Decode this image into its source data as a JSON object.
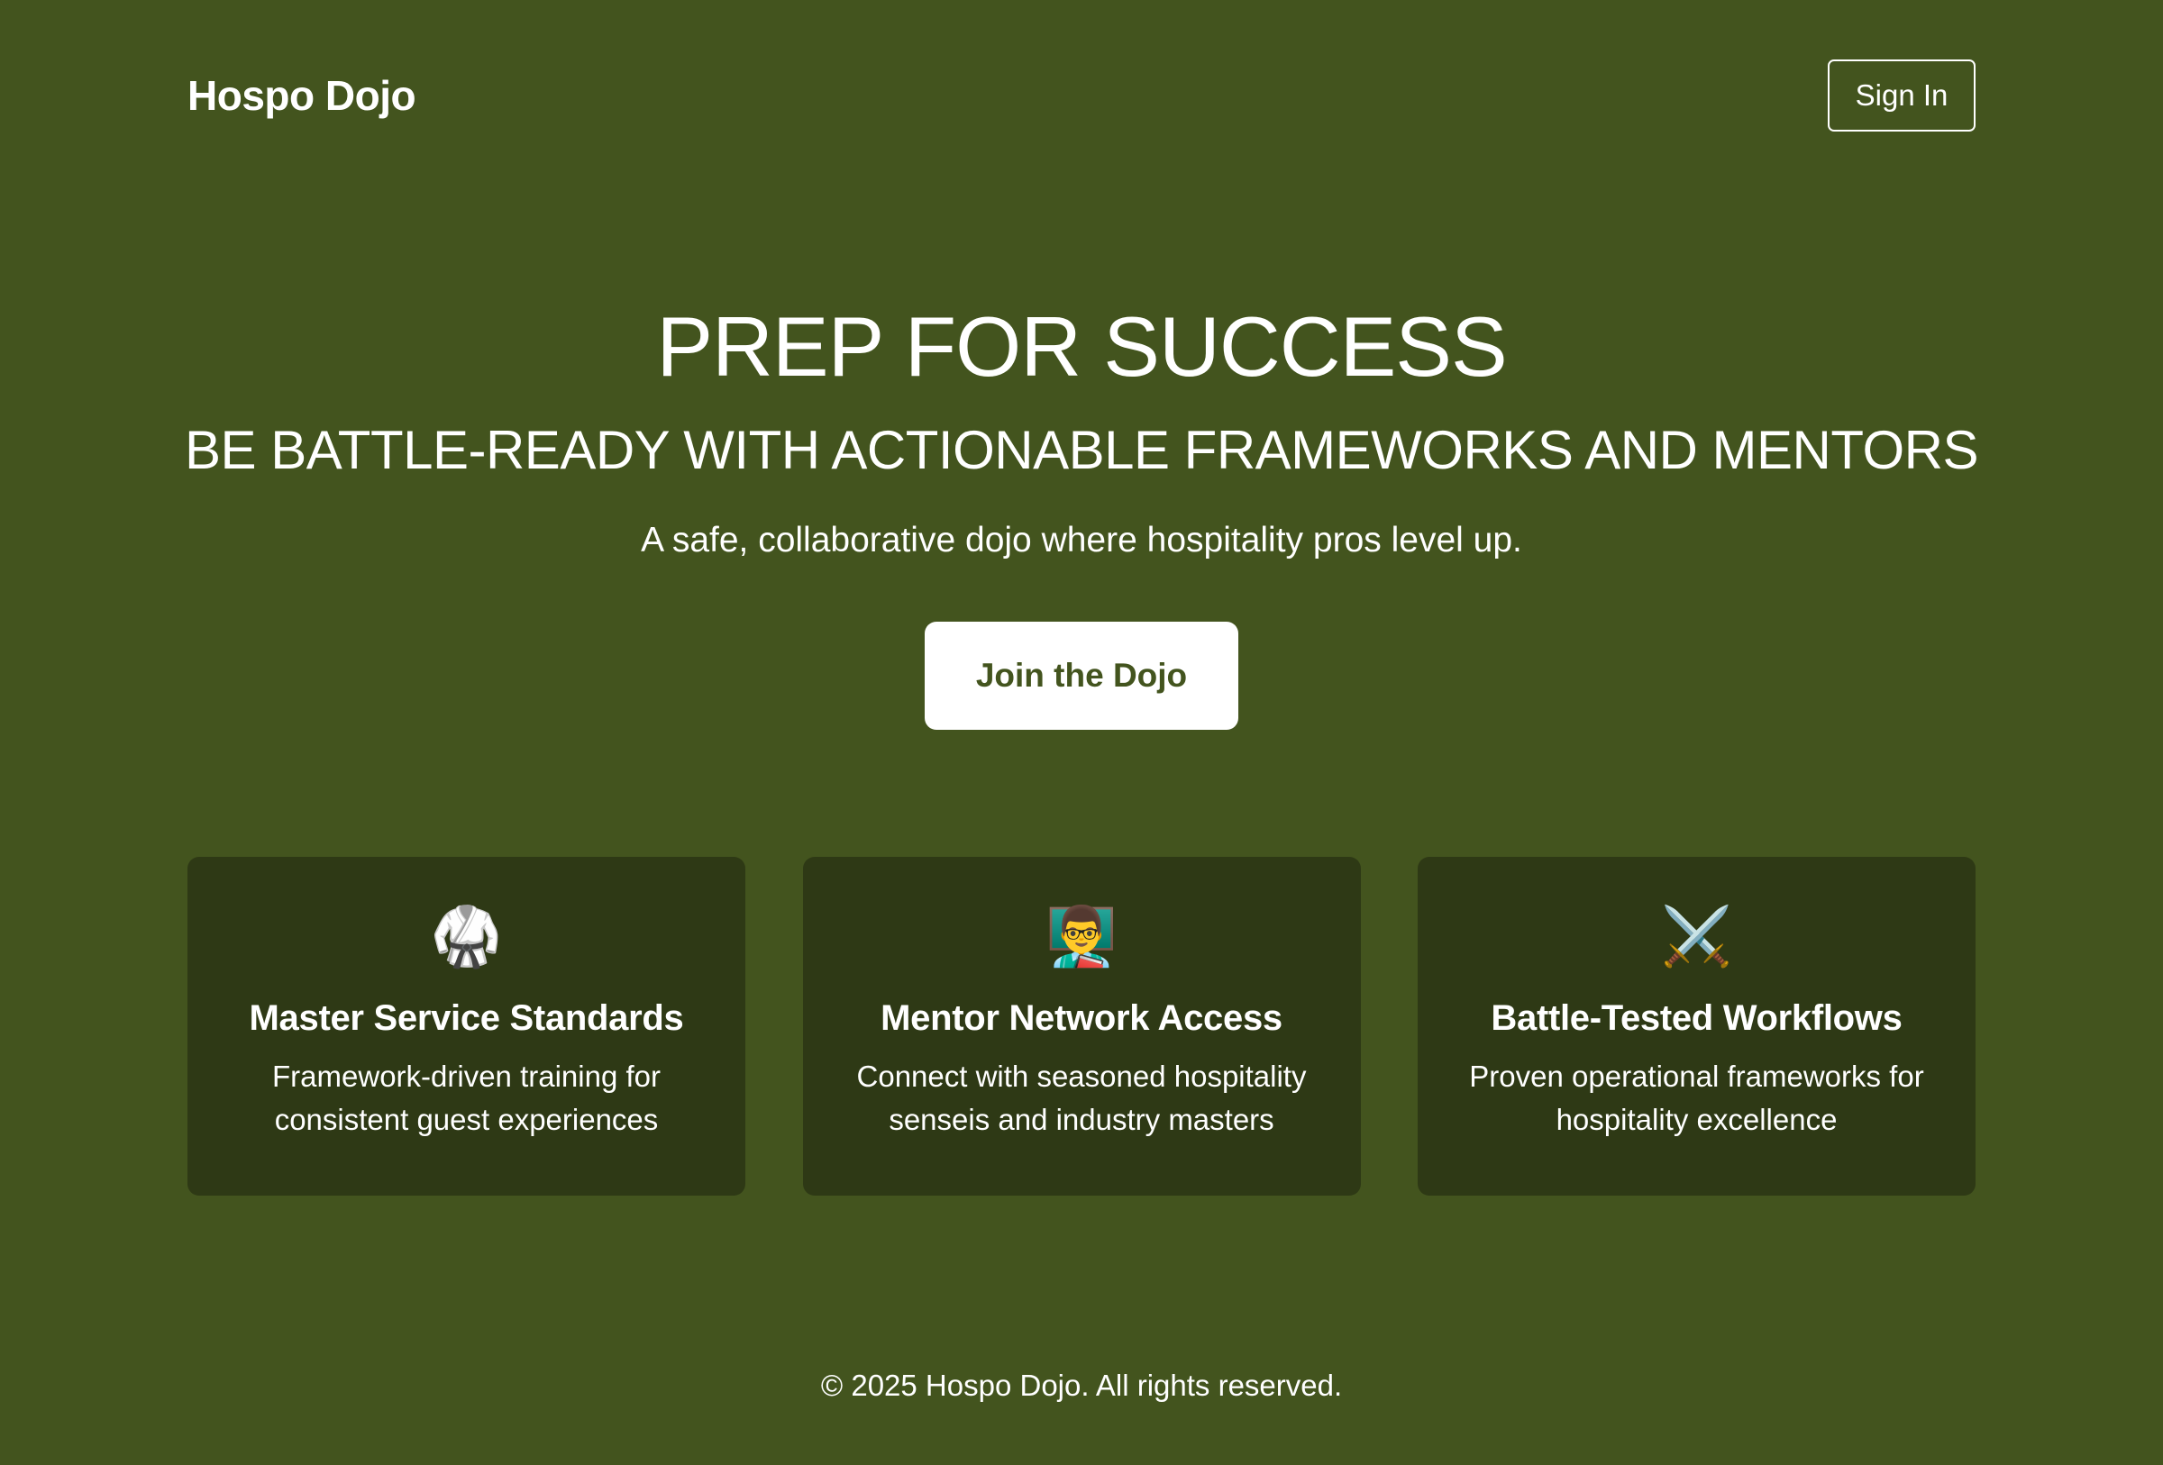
{
  "header": {
    "logo": "Hospo Dojo",
    "signin_label": "Sign In"
  },
  "hero": {
    "title": "PREP FOR SUCCESS",
    "subtitle": "BE BATTLE-READY WITH ACTIONABLE FRAMEWORKS AND MENTORS",
    "tagline": "A safe, collaborative dojo where hospitality pros level up.",
    "cta_label": "Join the Dojo"
  },
  "features": [
    {
      "icon": "🥋",
      "icon_name": "martial-arts-uniform-icon",
      "title": "Master Service Standards",
      "description": "Framework-driven training for consistent guest experiences"
    },
    {
      "icon": "👨‍🏫",
      "icon_name": "teacher-icon",
      "title": "Mentor Network Access",
      "description": "Connect with seasoned hospitality senseis and industry masters"
    },
    {
      "icon": "⚔️",
      "icon_name": "crossed-swords-icon",
      "title": "Battle-Tested Workflows",
      "description": "Proven operational frameworks for hospitality excellence"
    }
  ],
  "footer": {
    "copyright": "© 2025 Hospo Dojo. All rights reserved."
  },
  "colors": {
    "background": "#43541e",
    "card_background": "#2e3915",
    "text": "#ffffff",
    "cta_text": "#43541e"
  }
}
